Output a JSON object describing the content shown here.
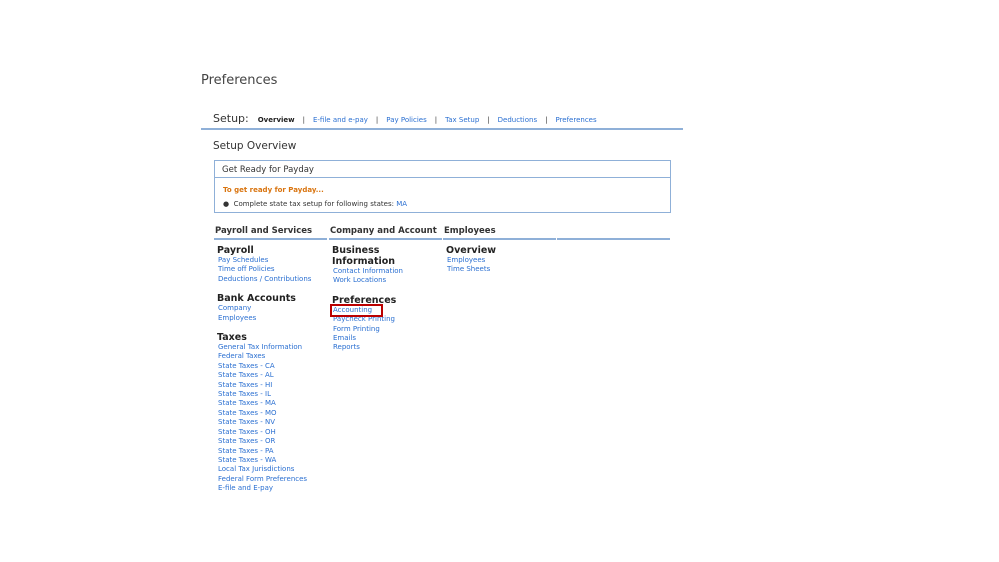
{
  "page_title": "Preferences",
  "setup": {
    "label": "Setup:",
    "tabs": [
      "Overview",
      "E-file and e-pay",
      "Pay Policies",
      "Tax Setup",
      "Deductions",
      "Preferences"
    ],
    "active": "Overview"
  },
  "overview_title": "Setup Overview",
  "payday": {
    "header": "Get Ready for Payday",
    "warning": "To get ready for Payday...",
    "item": "Complete state tax setup for following states:",
    "state_link": "MA"
  },
  "columns": [
    {
      "header": "Payroll and Services",
      "groups": [
        {
          "title": "Payroll",
          "links": [
            "Pay Schedules",
            "Time off Policies",
            "Deductions / Contributions"
          ]
        },
        {
          "title": "Bank Accounts",
          "links": [
            "Company",
            "Employees"
          ]
        },
        {
          "title": "Taxes",
          "links": [
            "General Tax Information",
            "Federal Taxes",
            "State Taxes - CA",
            "State Taxes - AL",
            "State Taxes - HI",
            "State Taxes - IL",
            "State Taxes - MA",
            "State Taxes - MO",
            "State Taxes - NV",
            "State Taxes - OH",
            "State Taxes - OR",
            "State Taxes - PA",
            "State Taxes - WA",
            "Local Tax Jurisdictions",
            "Federal Form Preferences",
            "E-file and E-pay"
          ]
        }
      ]
    },
    {
      "header": "Company and Account",
      "groups": [
        {
          "title": "Business Information",
          "links": [
            "Contact Information",
            "Work Locations"
          ]
        },
        {
          "title": "Preferences",
          "links": [
            "Accounting",
            "Paycheck Printing",
            "Form Printing",
            "Emails",
            "Reports"
          ]
        }
      ]
    },
    {
      "header": "Employees",
      "groups": [
        {
          "title": "Overview",
          "links": [
            "Employees",
            "Time Sheets"
          ]
        }
      ]
    },
    {
      "header": "",
      "groups": []
    }
  ],
  "highlighted_link": "Accounting"
}
